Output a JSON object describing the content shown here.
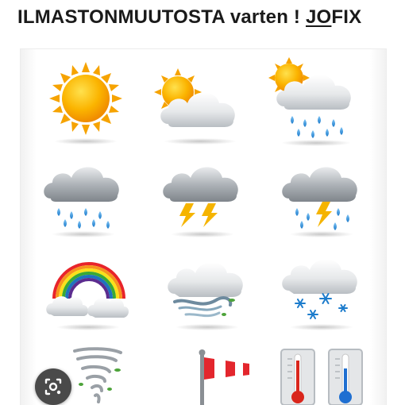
{
  "title": {
    "main": "ILMASTONMUUTOSTA varten ! ",
    "underlined": "JO",
    "rest": "FIX"
  },
  "colors": {
    "sun": "#f7a600",
    "cloud": "#cfd3d6",
    "rain": "#2f8fd8",
    "lightning": "#f5b400",
    "thermo_red": "#d9261c",
    "thermo_blue": "#1f6fd1",
    "lens_button": "#4a4a4a"
  },
  "icons": [
    "sun-icon",
    "sun-cloud-icon",
    "sun-cloud-rain-icon",
    "rain-cloud-icon",
    "storm-cloud-icon",
    "storm-rain-cloud-icon",
    "rainbow-icon",
    "wind-cloud-icon",
    "snow-cloud-icon",
    "tornado-icon",
    "windsock-icon",
    "hot-thermometer-icon",
    "cold-thermometer-icon"
  ],
  "lens_button": {
    "icon": "lens-search-icon"
  }
}
